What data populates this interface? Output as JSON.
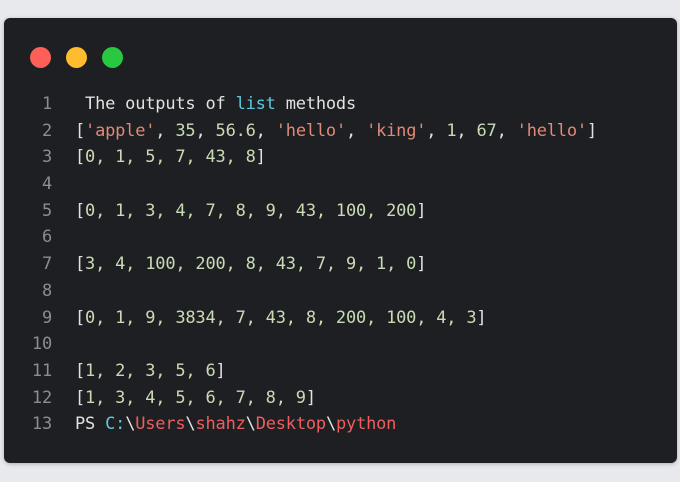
{
  "window": {
    "buttons": [
      {
        "name": "close",
        "color": "#ff5f57"
      },
      {
        "name": "minimize",
        "color": "#febc2e"
      },
      {
        "name": "maximize",
        "color": "#28c840"
      }
    ]
  },
  "colors": {
    "background": "#1e1f22",
    "string": "#e08a78",
    "number": "#c9dbb4",
    "keyword": "#5cc9e0",
    "path": "#ef5e5e"
  },
  "lines": [
    {
      "number": "1",
      "tokens": [
        {
          "text": " The outputs of ",
          "type": "plain"
        },
        {
          "text": "list",
          "type": "kw"
        },
        {
          "text": " methods",
          "type": "plain"
        }
      ]
    },
    {
      "number": "2",
      "tokens": [
        {
          "text": "[",
          "type": "plain"
        },
        {
          "text": "'apple'",
          "type": "str"
        },
        {
          "text": ", ",
          "type": "plain"
        },
        {
          "text": "35",
          "type": "num"
        },
        {
          "text": ", ",
          "type": "plain"
        },
        {
          "text": "56.6",
          "type": "num"
        },
        {
          "text": ", ",
          "type": "plain"
        },
        {
          "text": "'hello'",
          "type": "str"
        },
        {
          "text": ", ",
          "type": "plain"
        },
        {
          "text": "'king'",
          "type": "str"
        },
        {
          "text": ", ",
          "type": "plain"
        },
        {
          "text": "1",
          "type": "num"
        },
        {
          "text": ", ",
          "type": "plain"
        },
        {
          "text": "67",
          "type": "num"
        },
        {
          "text": ", ",
          "type": "plain"
        },
        {
          "text": "'hello'",
          "type": "str"
        },
        {
          "text": "]",
          "type": "plain"
        }
      ]
    },
    {
      "number": "3",
      "tokens": [
        {
          "text": "[",
          "type": "plain"
        },
        {
          "text": "0, 1, 5, 7, 43, 8",
          "type": "num"
        },
        {
          "text": "]",
          "type": "plain"
        }
      ]
    },
    {
      "number": "4",
      "tokens": []
    },
    {
      "number": "5",
      "tokens": [
        {
          "text": "[",
          "type": "plain"
        },
        {
          "text": "0, 1, 3, 4, 7, 8, 9, 43, 100, 200",
          "type": "num"
        },
        {
          "text": "]",
          "type": "plain"
        }
      ]
    },
    {
      "number": "6",
      "tokens": []
    },
    {
      "number": "7",
      "tokens": [
        {
          "text": "[",
          "type": "plain"
        },
        {
          "text": "3, 4, 100, 200, 8, 43, 7, 9, 1, 0",
          "type": "num"
        },
        {
          "text": "]",
          "type": "plain"
        }
      ]
    },
    {
      "number": "8",
      "tokens": []
    },
    {
      "number": "9",
      "tokens": [
        {
          "text": "[",
          "type": "plain"
        },
        {
          "text": "0, 1, 9, 3834, 7, 43, 8, 200, 100, 4, 3",
          "type": "num"
        },
        {
          "text": "]",
          "type": "plain"
        }
      ]
    },
    {
      "number": "10",
      "tokens": []
    },
    {
      "number": "11",
      "tokens": [
        {
          "text": "[",
          "type": "plain"
        },
        {
          "text": "1, 2, 3, 5, 6",
          "type": "num"
        },
        {
          "text": "]",
          "type": "plain"
        }
      ]
    },
    {
      "number": "12",
      "tokens": [
        {
          "text": "[",
          "type": "plain"
        },
        {
          "text": "1, 3, 4, 5, 6, 7, 8, 9",
          "type": "num"
        },
        {
          "text": "]",
          "type": "plain"
        }
      ]
    },
    {
      "number": "13",
      "tokens": [
        {
          "text": "PS ",
          "type": "plain"
        },
        {
          "text": "C:",
          "type": "kw"
        },
        {
          "text": "\\",
          "type": "plain"
        },
        {
          "text": "Users",
          "type": "path"
        },
        {
          "text": "\\",
          "type": "plain"
        },
        {
          "text": "shahz",
          "type": "path"
        },
        {
          "text": "\\",
          "type": "plain"
        },
        {
          "text": "Desktop",
          "type": "path"
        },
        {
          "text": "\\",
          "type": "plain"
        },
        {
          "text": "python",
          "type": "path"
        }
      ]
    }
  ]
}
